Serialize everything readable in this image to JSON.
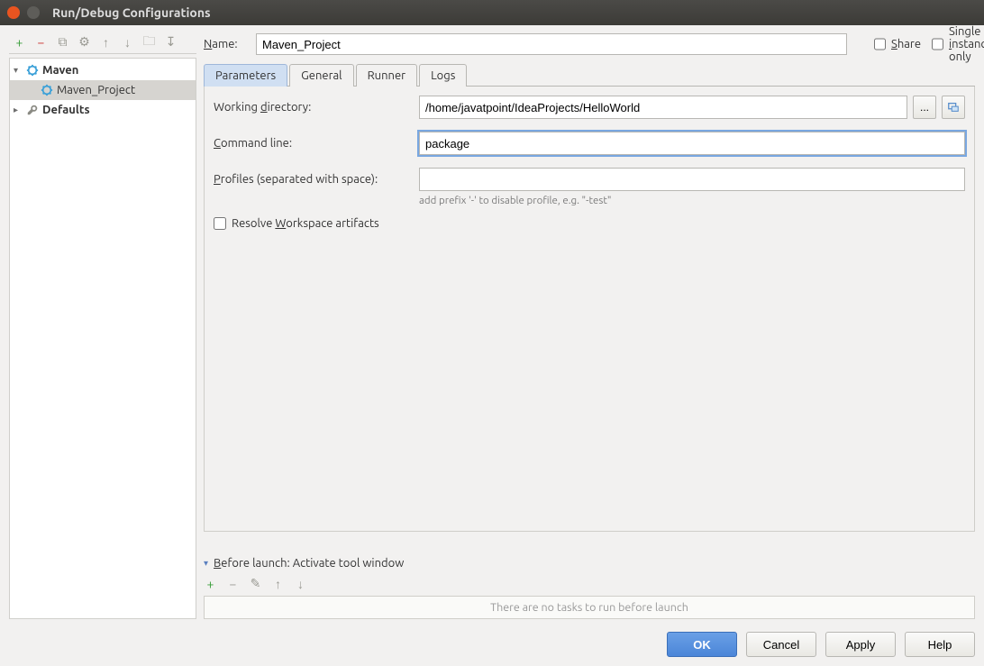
{
  "window": {
    "title": "Run/Debug Configurations"
  },
  "left_toolbar": {
    "add": "+",
    "remove": "−",
    "copy": "⧉",
    "settings": "⚙",
    "up": "↑",
    "down": "↓",
    "folder": "🗀",
    "sort": "↧"
  },
  "tree": {
    "maven_label": "Maven",
    "maven_child": "Maven_Project",
    "defaults_label": "Defaults"
  },
  "name": {
    "label": "Name:",
    "value": "Maven_Project"
  },
  "share": {
    "label": "Share"
  },
  "single_instance": {
    "label": "Single instance only"
  },
  "tabs": {
    "parameters": "Parameters",
    "general": "General",
    "runner": "Runner",
    "logs": "Logs"
  },
  "form": {
    "working_dir_label": "Working directory:",
    "working_dir_value": "/home/javatpoint/IdeaProjects/HelloWorld",
    "browse": "...",
    "command_line_label": "Command line:",
    "command_line_value": "package",
    "profiles_label": "Profiles (separated with space):",
    "profiles_value": "",
    "profiles_hint": "add prefix '-' to disable profile, e.g. \"-test\"",
    "resolve_label": "Resolve Workspace artifacts"
  },
  "before_launch": {
    "header": "Before launch: Activate tool window",
    "empty": "There are no tasks to run before launch"
  },
  "buttons": {
    "ok": "OK",
    "cancel": "Cancel",
    "apply": "Apply",
    "help": "Help"
  }
}
